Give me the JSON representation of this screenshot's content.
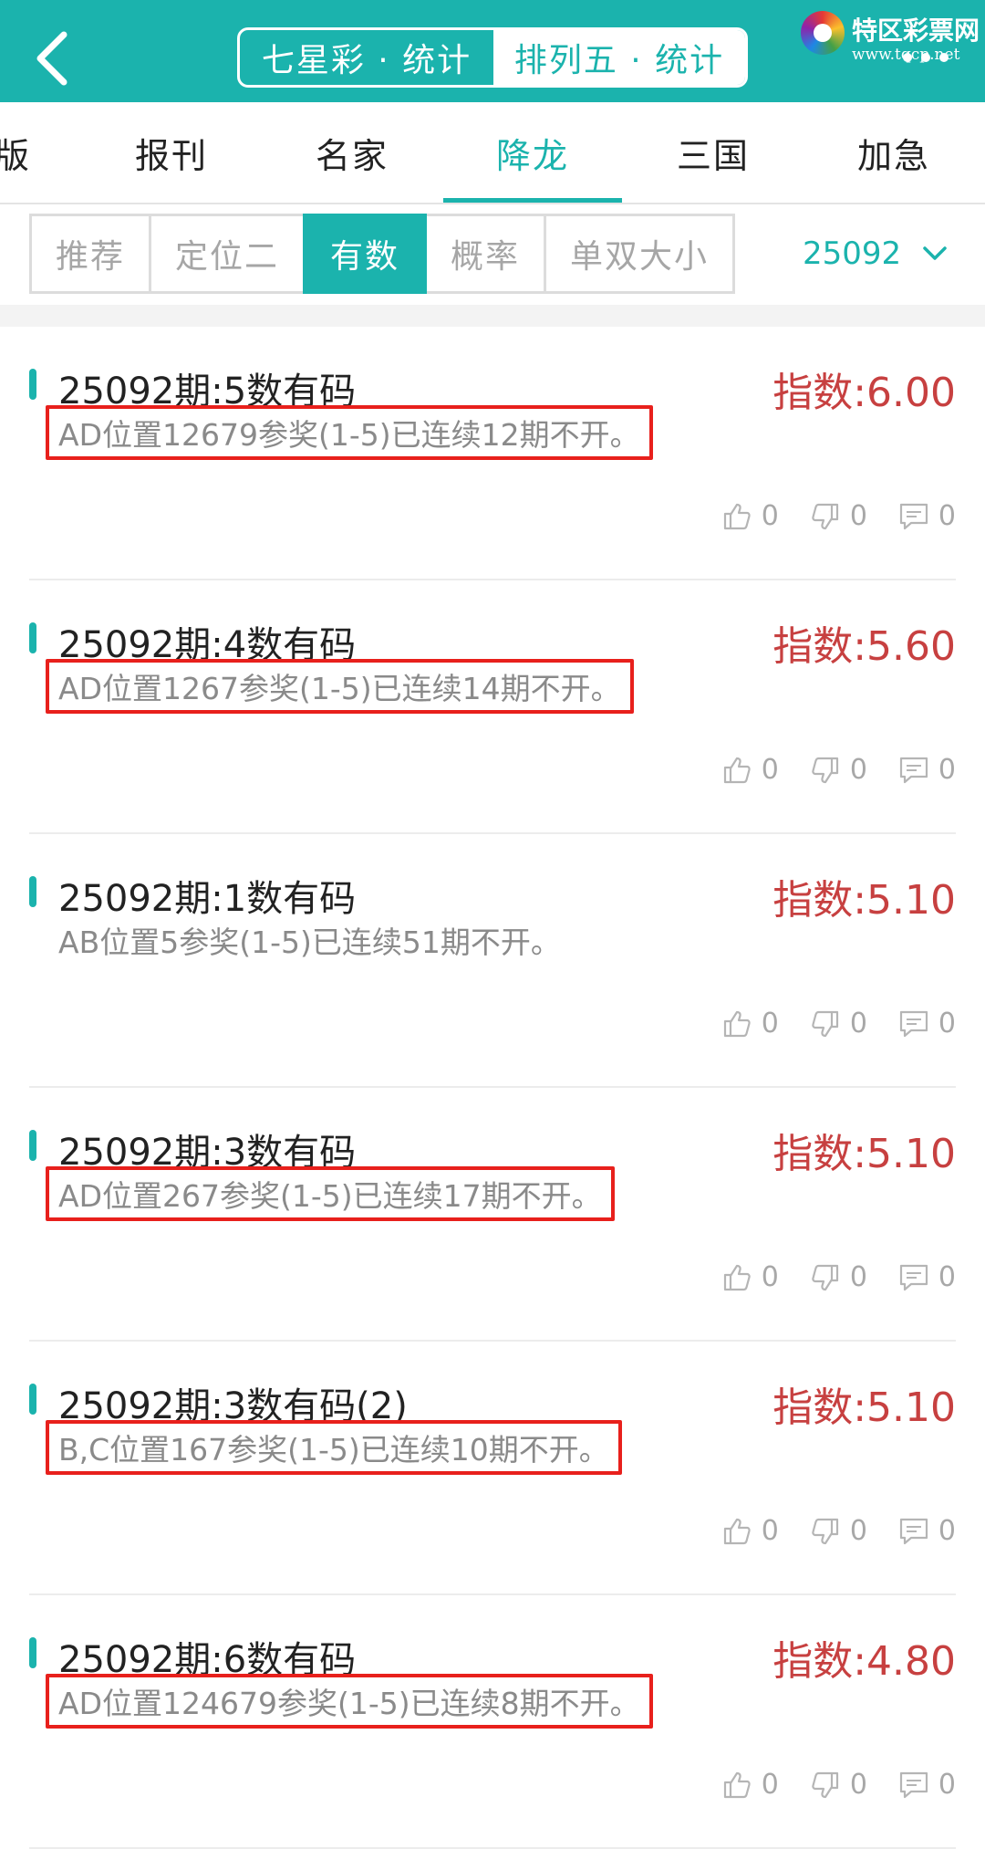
{
  "header": {
    "back_icon": "chevron-left-icon",
    "segments": [
      {
        "label": "七星彩 · 统计",
        "active": false
      },
      {
        "label": "排列五 · 统计",
        "active": true
      }
    ],
    "logo": {
      "name": "特区彩票网",
      "url": "www.tqcp.net"
    }
  },
  "tabs": [
    {
      "label": "版",
      "active": false
    },
    {
      "label": "报刊",
      "active": false
    },
    {
      "label": "名家",
      "active": false
    },
    {
      "label": "降龙",
      "active": true
    },
    {
      "label": "三国",
      "active": false
    },
    {
      "label": "加急",
      "active": false
    }
  ],
  "filters": [
    {
      "label": "推荐",
      "active": false
    },
    {
      "label": "定位二",
      "active": false
    },
    {
      "label": "有数",
      "active": true
    },
    {
      "label": "概率",
      "active": false
    },
    {
      "label": "单双大小",
      "active": false
    }
  ],
  "period": {
    "value": "25092",
    "icon": "chevron-down-icon"
  },
  "items": [
    {
      "title": "25092期:5数有码",
      "score": "指数:6.00",
      "desc": "AD位置12679参奖(1-5)已连续12期不开。",
      "highlighted": true,
      "likes": "0",
      "dislikes": "0",
      "comments": "0"
    },
    {
      "title": "25092期:4数有码",
      "score": "指数:5.60",
      "desc": "AD位置1267参奖(1-5)已连续14期不开。",
      "highlighted": true,
      "likes": "0",
      "dislikes": "0",
      "comments": "0"
    },
    {
      "title": "25092期:1数有码",
      "score": "指数:5.10",
      "desc": "AB位置5参奖(1-5)已连续51期不开。",
      "highlighted": false,
      "likes": "0",
      "dislikes": "0",
      "comments": "0"
    },
    {
      "title": "25092期:3数有码",
      "score": "指数:5.10",
      "desc": "AD位置267参奖(1-5)已连续17期不开。",
      "highlighted": true,
      "likes": "0",
      "dislikes": "0",
      "comments": "0"
    },
    {
      "title": "25092期:3数有码(2)",
      "score": "指数:5.10",
      "desc": "B,C位置167参奖(1-5)已连续10期不开。",
      "highlighted": true,
      "likes": "0",
      "dislikes": "0",
      "comments": "0"
    },
    {
      "title": "25092期:6数有码",
      "score": "指数:4.80",
      "desc": "AD位置124679参奖(1-5)已连续8期不开。",
      "highlighted": true,
      "likes": "0",
      "dislikes": "0",
      "comments": "0"
    }
  ],
  "colors": {
    "accent": "#1bb3ad",
    "score": "#c74040",
    "highlight_box": "#e8201c"
  }
}
